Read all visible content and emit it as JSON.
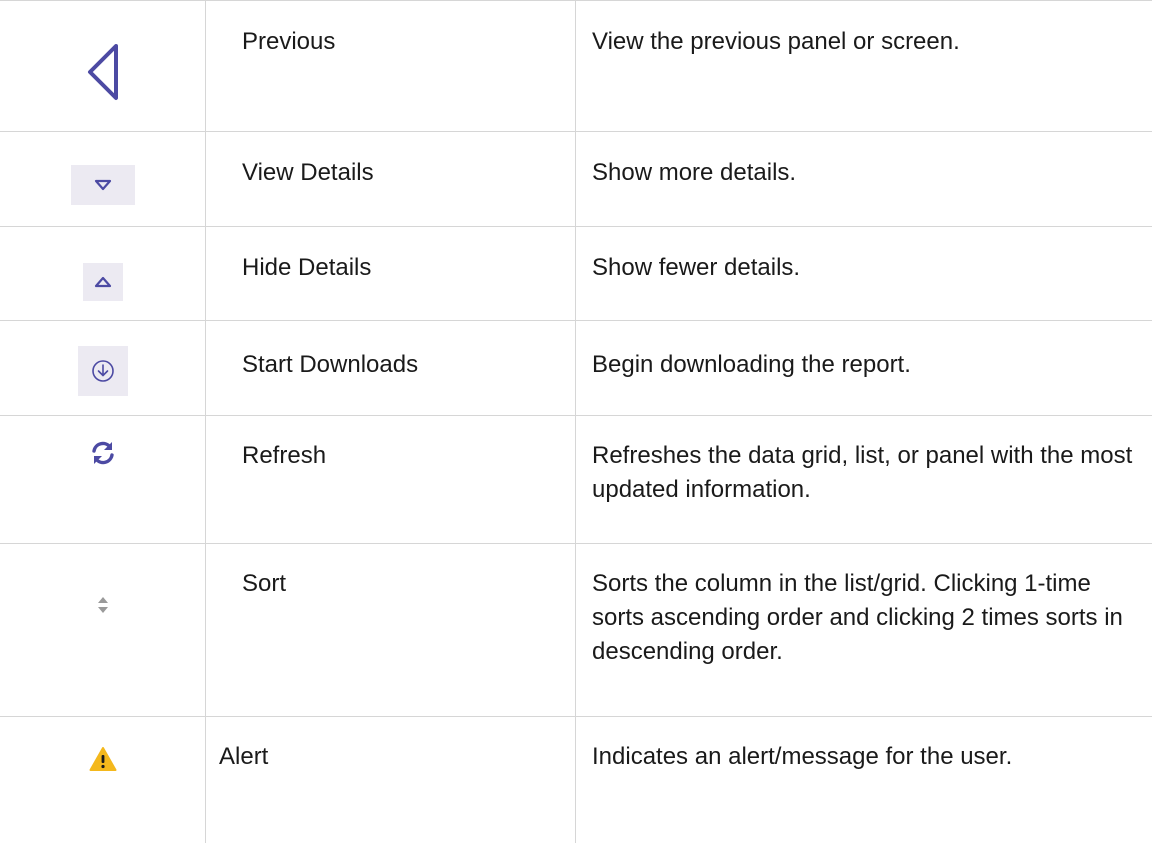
{
  "rows": [
    {
      "icon": "previous-triangle-icon",
      "name": "Previous",
      "description": "View the previous panel or screen."
    },
    {
      "icon": "chevron-down-icon",
      "name": "View Details",
      "description": "Show more details."
    },
    {
      "icon": "chevron-up-icon",
      "name": "Hide Details",
      "description": "Show fewer details."
    },
    {
      "icon": "download-circle-icon",
      "name": "Start Downloads",
      "description": "Begin downloading the report."
    },
    {
      "icon": "refresh-icon",
      "name": "Refresh",
      "description": "Refreshes the data grid, list, or panel with the most updated information."
    },
    {
      "icon": "sort-icon",
      "name": "Sort",
      "description": "Sorts the column in the list/grid. Clicking 1-time sorts ascending order and clicking 2 times sorts in descending order."
    },
    {
      "icon": "alert-icon",
      "name": "Alert",
      "description": "Indicates an alert/message for the user."
    }
  ],
  "colors": {
    "icon_purple": "#4c4aa3",
    "chip_bg": "#eceaf2",
    "sort_gray": "#9a9a9a",
    "alert_yellow": "#f4b81c",
    "grid_line": "#d6d6d6"
  }
}
